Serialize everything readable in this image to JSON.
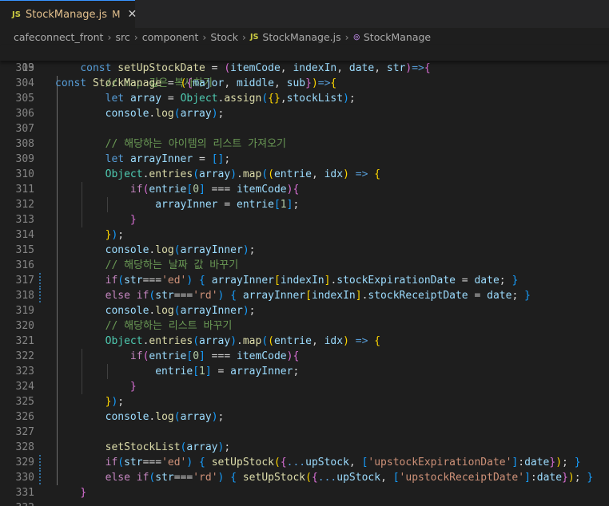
{
  "tab": {
    "file_type": "JS",
    "filename": "StockManage.js",
    "status": "M",
    "close_glyph": "✕"
  },
  "breadcrumb": {
    "items": [
      "cafeconnect_front",
      "src",
      "component",
      "Stock"
    ],
    "file_type": "JS",
    "file": "StockManage.js",
    "symbol_icon": "symbol-class-icon",
    "symbol": "StockManage"
  },
  "colors": {
    "keyword": "#569cd6",
    "control": "#c586c0",
    "function": "#dcdcaa",
    "variable": "#9cdcfe",
    "class": "#4ec9b0",
    "string": "#ce9178",
    "number": "#b5cea8",
    "comment": "#6a9955",
    "bracket1": "#ffd700",
    "bracket2": "#da70d6",
    "bracket3": "#179fff"
  },
  "sticky_line": {
    "number": "19",
    "tokens": [
      [
        "kw",
        "const "
      ],
      [
        "fn",
        "StockManage"
      ],
      [
        "pun",
        " = "
      ],
      [
        "b1",
        "("
      ],
      [
        "b2",
        "{"
      ],
      [
        "var",
        "major"
      ],
      [
        "pun",
        ", "
      ],
      [
        "var",
        "middle"
      ],
      [
        "pun",
        ", "
      ],
      [
        "var",
        "sub"
      ],
      [
        "b2",
        "}"
      ],
      [
        "b1",
        ")"
      ],
      [
        "kw",
        "=>"
      ],
      [
        "b1",
        "{"
      ]
    ]
  },
  "lines": [
    {
      "n": "303",
      "indent": 1,
      "tokens": [
        [
          "kw",
          "const "
        ],
        [
          "fn",
          "setUpStockDate"
        ],
        [
          "pun",
          " = "
        ],
        [
          "b2",
          "("
        ],
        [
          "var",
          "itemCode"
        ],
        [
          "pun",
          ", "
        ],
        [
          "var",
          "indexIn"
        ],
        [
          "pun",
          ", "
        ],
        [
          "var",
          "date"
        ],
        [
          "pun",
          ", "
        ],
        [
          "var",
          "str"
        ],
        [
          "b2",
          ")"
        ],
        [
          "kw",
          "=>"
        ],
        [
          "b2",
          "{"
        ]
      ]
    },
    {
      "n": "304",
      "indent": 2,
      "tokens": [
        [
          "cmt",
          "// map 깊은 복사하기"
        ]
      ]
    },
    {
      "n": "305",
      "indent": 2,
      "tokens": [
        [
          "kw",
          "let "
        ],
        [
          "var",
          "array"
        ],
        [
          "pun",
          " = "
        ],
        [
          "cls",
          "Object"
        ],
        [
          "pun",
          "."
        ],
        [
          "fn",
          "assign"
        ],
        [
          "b3",
          "("
        ],
        [
          "b1",
          "{}"
        ],
        [
          "pun",
          ","
        ],
        [
          "var",
          "stockList"
        ],
        [
          "b3",
          ")"
        ],
        [
          "pun",
          ";"
        ]
      ]
    },
    {
      "n": "306",
      "indent": 2,
      "tokens": [
        [
          "var",
          "console"
        ],
        [
          "pun",
          "."
        ],
        [
          "fn",
          "log"
        ],
        [
          "b3",
          "("
        ],
        [
          "var",
          "array"
        ],
        [
          "b3",
          ")"
        ],
        [
          "pun",
          ";"
        ]
      ]
    },
    {
      "n": "307",
      "indent": 2,
      "tokens": []
    },
    {
      "n": "308",
      "indent": 2,
      "tokens": [
        [
          "cmt",
          "// 해당하는 아이템의 리스트 가져오기"
        ]
      ]
    },
    {
      "n": "309",
      "indent": 2,
      "tokens": [
        [
          "kw",
          "let "
        ],
        [
          "var",
          "arrayInner"
        ],
        [
          "pun",
          " = "
        ],
        [
          "b3",
          "[]"
        ],
        [
          "pun",
          ";"
        ]
      ]
    },
    {
      "n": "310",
      "indent": 2,
      "tokens": [
        [
          "cls",
          "Object"
        ],
        [
          "pun",
          "."
        ],
        [
          "fn",
          "entries"
        ],
        [
          "b3",
          "("
        ],
        [
          "var",
          "array"
        ],
        [
          "b3",
          ")"
        ],
        [
          "pun",
          "."
        ],
        [
          "fn",
          "map"
        ],
        [
          "b3",
          "("
        ],
        [
          "b1",
          "("
        ],
        [
          "var",
          "entrie"
        ],
        [
          "pun",
          ", "
        ],
        [
          "var",
          "idx"
        ],
        [
          "b1",
          ")"
        ],
        [
          "kw",
          " => "
        ],
        [
          "b1",
          "{"
        ]
      ]
    },
    {
      "n": "311",
      "indent": 3,
      "tokens": [
        [
          "ctl",
          "if"
        ],
        [
          "b2",
          "("
        ],
        [
          "var",
          "entrie"
        ],
        [
          "b3",
          "["
        ],
        [
          "num",
          "0"
        ],
        [
          "b3",
          "]"
        ],
        [
          "pun",
          " === "
        ],
        [
          "var",
          "itemCode"
        ],
        [
          "b2",
          ")"
        ],
        [
          "b2",
          "{"
        ]
      ]
    },
    {
      "n": "312",
      "indent": 4,
      "tokens": [
        [
          "var",
          "arrayInner"
        ],
        [
          "pun",
          " = "
        ],
        [
          "var",
          "entrie"
        ],
        [
          "b3",
          "["
        ],
        [
          "num",
          "1"
        ],
        [
          "b3",
          "]"
        ],
        [
          "pun",
          ";"
        ]
      ]
    },
    {
      "n": "313",
      "indent": 3,
      "tokens": [
        [
          "b2",
          "}"
        ]
      ]
    },
    {
      "n": "314",
      "indent": 2,
      "tokens": [
        [
          "b1",
          "}"
        ],
        [
          "b3",
          ")"
        ],
        [
          "pun",
          ";"
        ]
      ]
    },
    {
      "n": "315",
      "indent": 2,
      "tokens": [
        [
          "var",
          "console"
        ],
        [
          "pun",
          "."
        ],
        [
          "fn",
          "log"
        ],
        [
          "b3",
          "("
        ],
        [
          "var",
          "arrayInner"
        ],
        [
          "b3",
          ")"
        ],
        [
          "pun",
          ";"
        ]
      ]
    },
    {
      "n": "316",
      "indent": 2,
      "tokens": [
        [
          "cmt",
          "// 해당하는 날짜 값 바꾸기"
        ]
      ]
    },
    {
      "n": "317",
      "indent": 2,
      "mod": true,
      "tokens": [
        [
          "ctl",
          "if"
        ],
        [
          "b3",
          "("
        ],
        [
          "var",
          "str"
        ],
        [
          "pun",
          "==="
        ],
        [
          "str",
          "'ed'"
        ],
        [
          "b3",
          ")"
        ],
        [
          "pun",
          " "
        ],
        [
          "b3",
          "{"
        ],
        [
          "pun",
          " "
        ],
        [
          "var",
          "arrayInner"
        ],
        [
          "b1",
          "["
        ],
        [
          "var",
          "indexIn"
        ],
        [
          "b1",
          "]"
        ],
        [
          "pun",
          "."
        ],
        [
          "var",
          "stockExpirationDate"
        ],
        [
          "pun",
          " = "
        ],
        [
          "var",
          "date"
        ],
        [
          "pun",
          "; "
        ],
        [
          "b3",
          "}"
        ]
      ]
    },
    {
      "n": "318",
      "indent": 2,
      "mod": true,
      "tokens": [
        [
          "ctl",
          "else if"
        ],
        [
          "b3",
          "("
        ],
        [
          "var",
          "str"
        ],
        [
          "pun",
          "==="
        ],
        [
          "str",
          "'rd'"
        ],
        [
          "b3",
          ")"
        ],
        [
          "pun",
          " "
        ],
        [
          "b3",
          "{"
        ],
        [
          "pun",
          " "
        ],
        [
          "var",
          "arrayInner"
        ],
        [
          "b1",
          "["
        ],
        [
          "var",
          "indexIn"
        ],
        [
          "b1",
          "]"
        ],
        [
          "pun",
          "."
        ],
        [
          "var",
          "stockReceiptDate"
        ],
        [
          "pun",
          " = "
        ],
        [
          "var",
          "date"
        ],
        [
          "pun",
          "; "
        ],
        [
          "b3",
          "}"
        ]
      ]
    },
    {
      "n": "319",
      "indent": 2,
      "tokens": [
        [
          "var",
          "console"
        ],
        [
          "pun",
          "."
        ],
        [
          "fn",
          "log"
        ],
        [
          "b3",
          "("
        ],
        [
          "var",
          "arrayInner"
        ],
        [
          "b3",
          ")"
        ],
        [
          "pun",
          ";"
        ]
      ]
    },
    {
      "n": "320",
      "indent": 2,
      "tokens": [
        [
          "cmt",
          "// 해당하는 리스트 바꾸기"
        ]
      ]
    },
    {
      "n": "321",
      "indent": 2,
      "tokens": [
        [
          "cls",
          "Object"
        ],
        [
          "pun",
          "."
        ],
        [
          "fn",
          "entries"
        ],
        [
          "b3",
          "("
        ],
        [
          "var",
          "array"
        ],
        [
          "b3",
          ")"
        ],
        [
          "pun",
          "."
        ],
        [
          "fn",
          "map"
        ],
        [
          "b3",
          "("
        ],
        [
          "b1",
          "("
        ],
        [
          "var",
          "entrie"
        ],
        [
          "pun",
          ", "
        ],
        [
          "var",
          "idx"
        ],
        [
          "b1",
          ")"
        ],
        [
          "kw",
          " => "
        ],
        [
          "b1",
          "{"
        ]
      ]
    },
    {
      "n": "322",
      "indent": 3,
      "tokens": [
        [
          "ctl",
          "if"
        ],
        [
          "b2",
          "("
        ],
        [
          "var",
          "entrie"
        ],
        [
          "b3",
          "["
        ],
        [
          "num",
          "0"
        ],
        [
          "b3",
          "]"
        ],
        [
          "pun",
          " === "
        ],
        [
          "var",
          "itemCode"
        ],
        [
          "b2",
          ")"
        ],
        [
          "b2",
          "{"
        ]
      ]
    },
    {
      "n": "323",
      "indent": 4,
      "tokens": [
        [
          "var",
          "entrie"
        ],
        [
          "b3",
          "["
        ],
        [
          "num",
          "1"
        ],
        [
          "b3",
          "]"
        ],
        [
          "pun",
          " = "
        ],
        [
          "var",
          "arrayInner"
        ],
        [
          "pun",
          ";"
        ]
      ]
    },
    {
      "n": "324",
      "indent": 3,
      "tokens": [
        [
          "b2",
          "}"
        ]
      ]
    },
    {
      "n": "325",
      "indent": 2,
      "tokens": [
        [
          "b1",
          "}"
        ],
        [
          "b3",
          ")"
        ],
        [
          "pun",
          ";"
        ]
      ]
    },
    {
      "n": "326",
      "indent": 2,
      "tokens": [
        [
          "var",
          "console"
        ],
        [
          "pun",
          "."
        ],
        [
          "fn",
          "log"
        ],
        [
          "b3",
          "("
        ],
        [
          "var",
          "array"
        ],
        [
          "b3",
          ")"
        ],
        [
          "pun",
          ";"
        ]
      ]
    },
    {
      "n": "327",
      "indent": 2,
      "tokens": []
    },
    {
      "n": "328",
      "indent": 2,
      "tokens": [
        [
          "fn",
          "setStockList"
        ],
        [
          "b3",
          "("
        ],
        [
          "var",
          "array"
        ],
        [
          "b3",
          ")"
        ],
        [
          "pun",
          ";"
        ]
      ]
    },
    {
      "n": "329",
      "indent": 2,
      "mod": true,
      "tokens": [
        [
          "ctl",
          "if"
        ],
        [
          "b3",
          "("
        ],
        [
          "var",
          "str"
        ],
        [
          "pun",
          "==="
        ],
        [
          "str",
          "'ed'"
        ],
        [
          "b3",
          ")"
        ],
        [
          "pun",
          " "
        ],
        [
          "b3",
          "{"
        ],
        [
          "pun",
          " "
        ],
        [
          "fn",
          "setUpStock"
        ],
        [
          "b1",
          "("
        ],
        [
          "b2",
          "{"
        ],
        [
          "kw",
          "..."
        ],
        [
          "var",
          "upStock"
        ],
        [
          "pun",
          ", "
        ],
        [
          "b3",
          "["
        ],
        [
          "str",
          "'upstockExpirationDate'"
        ],
        [
          "b3",
          "]"
        ],
        [
          "pun",
          ":"
        ],
        [
          "var",
          "date"
        ],
        [
          "b2",
          "}"
        ],
        [
          "b1",
          ")"
        ],
        [
          "pun",
          "; "
        ],
        [
          "b3",
          "}"
        ]
      ]
    },
    {
      "n": "330",
      "indent": 2,
      "mod": true,
      "tokens": [
        [
          "ctl",
          "else if"
        ],
        [
          "b3",
          "("
        ],
        [
          "var",
          "str"
        ],
        [
          "pun",
          "==="
        ],
        [
          "str",
          "'rd'"
        ],
        [
          "b3",
          ")"
        ],
        [
          "pun",
          " "
        ],
        [
          "b3",
          "{"
        ],
        [
          "pun",
          " "
        ],
        [
          "fn",
          "setUpStock"
        ],
        [
          "b1",
          "("
        ],
        [
          "b2",
          "{"
        ],
        [
          "kw",
          "..."
        ],
        [
          "var",
          "upStock"
        ],
        [
          "pun",
          ", "
        ],
        [
          "b3",
          "["
        ],
        [
          "str",
          "'upstockReceiptDate'"
        ],
        [
          "b3",
          "]"
        ],
        [
          "pun",
          ":"
        ],
        [
          "var",
          "date"
        ],
        [
          "b2",
          "}"
        ],
        [
          "b1",
          ")"
        ],
        [
          "pun",
          "; "
        ],
        [
          "b3",
          "}"
        ]
      ]
    },
    {
      "n": "331",
      "indent": 1,
      "tokens": [
        [
          "b2",
          "}"
        ]
      ]
    },
    {
      "n": "332",
      "indent": 1,
      "tokens": []
    }
  ]
}
